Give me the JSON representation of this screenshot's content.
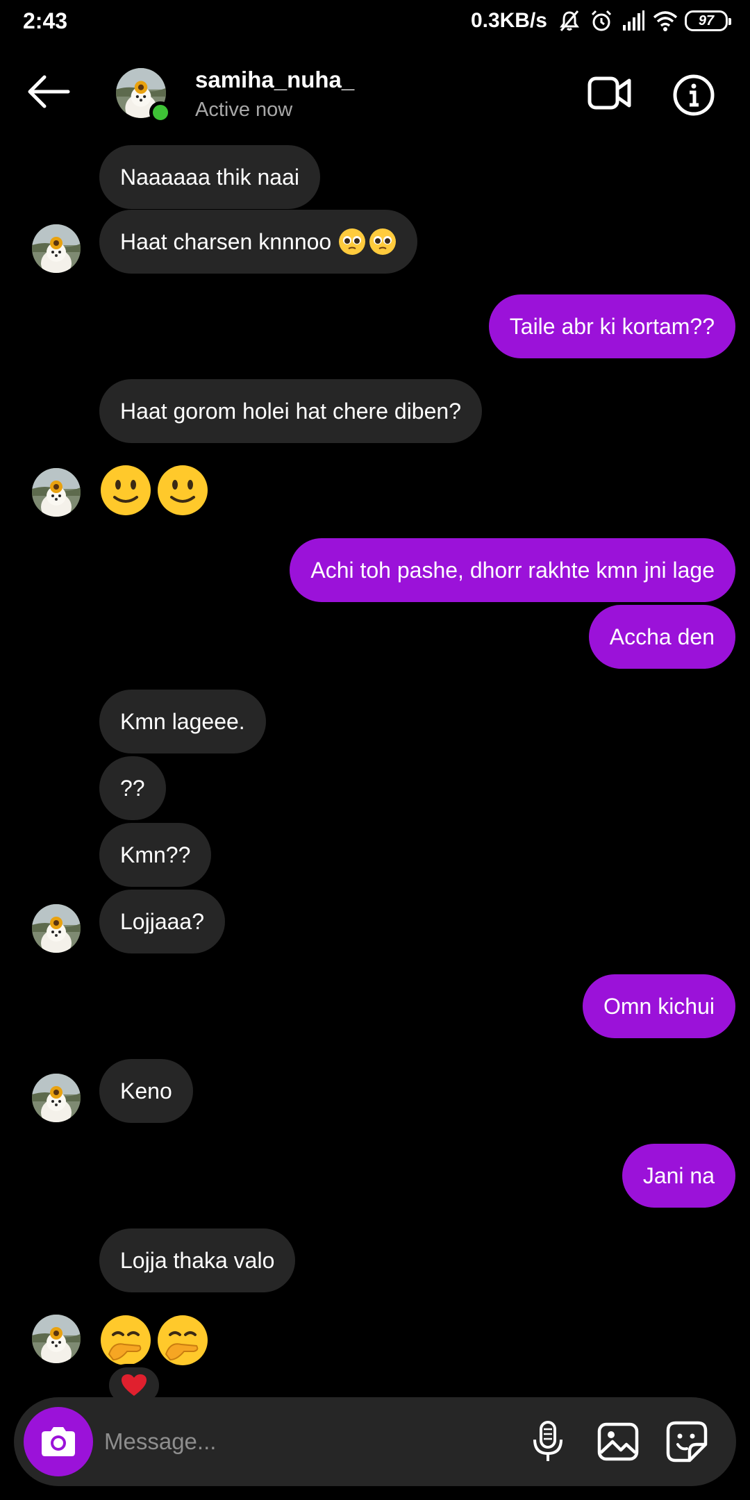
{
  "status_bar": {
    "time": "2:43",
    "net_speed": "0.3KB/s",
    "battery": "97"
  },
  "header": {
    "username": "samiha_nuha_",
    "status": "Active now"
  },
  "messages": [
    {
      "dir": "in",
      "text": "Naaaaaa thik naai"
    },
    {
      "dir": "in",
      "text": "Haat charsen knnnoo"
    },
    {
      "dir": "out",
      "text": "Taile abr ki kortam??"
    },
    {
      "dir": "in",
      "text": "Haat gorom holei hat chere diben?"
    },
    {
      "dir": "out",
      "text": "Achi toh pashe, dhorr rakhte kmn jni lage"
    },
    {
      "dir": "out",
      "text": "Accha den"
    },
    {
      "dir": "in",
      "text": "Kmn lageee."
    },
    {
      "dir": "in",
      "text": "??"
    },
    {
      "dir": "in",
      "text": "Kmn??"
    },
    {
      "dir": "in",
      "text": "Lojjaaa?"
    },
    {
      "dir": "out",
      "text": "Omn kichui"
    },
    {
      "dir": "in",
      "text": "Keno"
    },
    {
      "dir": "out",
      "text": "Jani na"
    },
    {
      "dir": "in",
      "text": "Lojja thaka valo"
    }
  ],
  "emoji_messages": [
    {
      "icons": [
        "slightly-smiling-face",
        "slightly-smiling-face"
      ]
    },
    {
      "icons": [
        "hand-over-mouth-face",
        "hand-over-mouth-face"
      ]
    }
  ],
  "reaction": "red-heart",
  "composer": {
    "placeholder": "Message..."
  },
  "colors": {
    "outgoing_bubble": "#9b12d9",
    "incoming_bubble": "#262626",
    "online_dot": "#3ec336",
    "background": "#000000"
  }
}
